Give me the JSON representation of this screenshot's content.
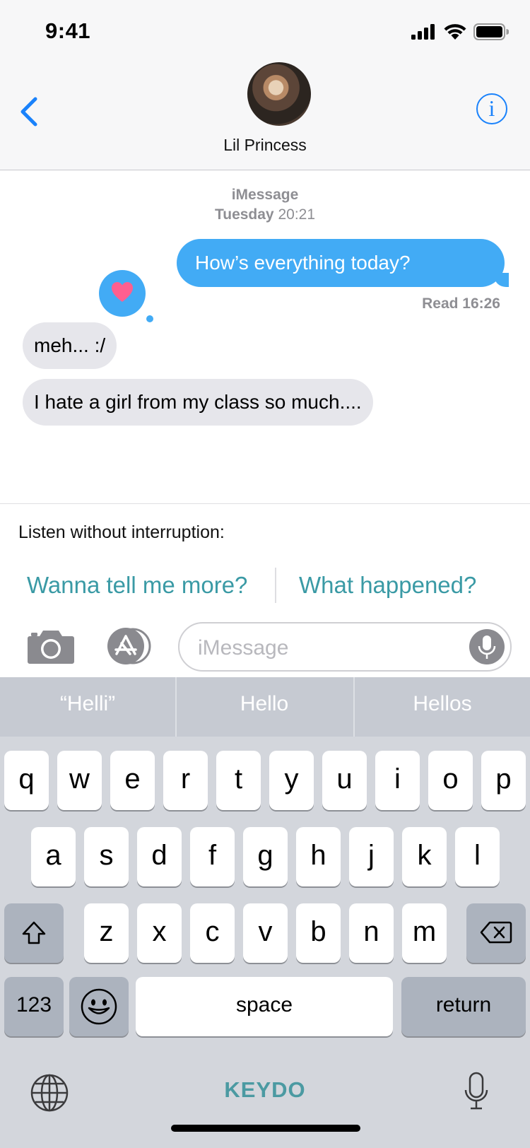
{
  "status_bar": {
    "time": "9:41"
  },
  "nav": {
    "contact_name": "Lil Princess",
    "info_label": "i"
  },
  "thread": {
    "service_label": "iMessage",
    "timestamp_day": "Tuesday",
    "timestamp_time": "20:21",
    "outgoing_message": "How’s everything today?",
    "read_receipt": "Read 16:26",
    "tapback_color": "#ff5f8f",
    "incoming_messages": [
      "meh... :/",
      "I hate a girl from my class so much...."
    ]
  },
  "suggestions": {
    "heading": "Listen without interruption:",
    "items": [
      "Wanna tell me more?",
      "What happened?"
    ]
  },
  "input": {
    "placeholder": "iMessage"
  },
  "keyboard": {
    "predictions": [
      "“Helli”",
      "Hello",
      "Hellos"
    ],
    "row1": [
      "q",
      "w",
      "e",
      "r",
      "t",
      "y",
      "u",
      "i",
      "o",
      "p"
    ],
    "row2": [
      "a",
      "s",
      "d",
      "f",
      "g",
      "h",
      "j",
      "k",
      "l"
    ],
    "row3": [
      "z",
      "x",
      "c",
      "v",
      "b",
      "n",
      "m"
    ],
    "numbers_key": "123",
    "space_key": "space",
    "return_key": "return",
    "brand": "KEYDO"
  },
  "colors": {
    "accent": "#1a82fb",
    "bubble_out": "#42abf5",
    "bubble_in": "#e6e6eb",
    "suggestion": "#3a9aa5"
  }
}
